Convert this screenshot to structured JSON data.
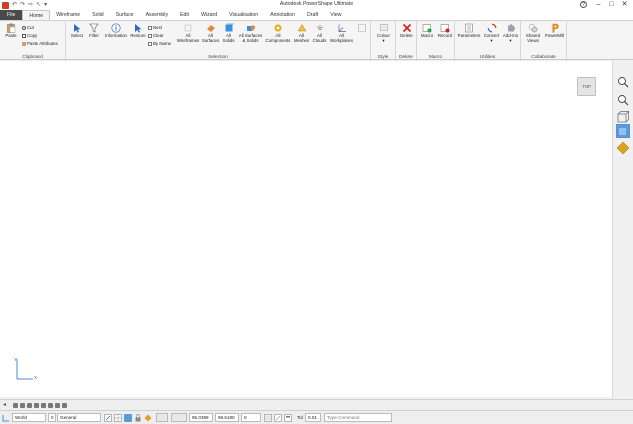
{
  "window": {
    "title": "Autodesk PowerShape Ultimate",
    "help_glyph": "?",
    "minimize": "–",
    "maximize": "□",
    "close": "✕"
  },
  "qat": {
    "icons": [
      "app-logo-icon",
      "undo-icon",
      "redo-icon",
      "pin-icon",
      "select-icon",
      "dropdown-icon"
    ]
  },
  "tabs": [
    "File",
    "Home",
    "Wireframe",
    "Solid",
    "Surface",
    "Assembly",
    "Edit",
    "Wizard",
    "Visualisation",
    "Annotation",
    "Draft",
    "View"
  ],
  "active_tab": "Home",
  "ribbon": {
    "clipboard": {
      "label": "Clipboard",
      "paste": "Paste",
      "cut": "Cut",
      "copy": "Copy",
      "paste_attributes": "Paste Attributes"
    },
    "selection": {
      "label": "Selection",
      "select": "Select",
      "filter": "Filter",
      "information": "Information",
      "restore": "Restore",
      "next": "Next",
      "clear": "Clear",
      "by_name": "By Name",
      "all_wireframes": [
        "All",
        "Wireframes"
      ],
      "all_surfaces": [
        "All",
        "Surfaces"
      ],
      "all_solids": [
        "All",
        "Solids"
      ],
      "all_surfaces_solids": [
        "All Surfaces",
        "& Solids"
      ],
      "all_components": [
        "All",
        "Components"
      ],
      "all_meshes": [
        "All",
        "Meshes"
      ],
      "all_clouds": [
        "All",
        "Clouds"
      ],
      "all_workplanes": [
        "All",
        "Workplanes"
      ]
    },
    "style": {
      "label": "Style",
      "colour": "Colour"
    },
    "delete": {
      "label": "Delete",
      "delete": "Delete"
    },
    "macro": {
      "label": "Macro",
      "macro": "Macro",
      "record": "Record"
    },
    "utilities": {
      "label": "Utilities",
      "parameters": "Parameters",
      "convert": "Convert",
      "addins": "Add-Ins"
    },
    "collaborate": {
      "label": "Collaborate",
      "shared_views": [
        "Shared",
        "Views"
      ],
      "powermill": "PowerMill"
    }
  },
  "canvas": {
    "viewcube_label": "TOP",
    "axis_x": "X",
    "axis_y": "Y"
  },
  "view_toolbar": [
    "zoom-fit-icon",
    "zoom-icon",
    "wireframe-box-icon",
    "shaded-view-icon",
    "material-view-icon"
  ],
  "statusbar": {
    "workplane": "World",
    "level": "0",
    "level_name": "General",
    "x": "95.0398",
    "y": "98.6180",
    "z": "0",
    "tol_label": "Tol",
    "tol_value": "0.01",
    "command_placeholder": "Type Command"
  },
  "colors": {
    "file_tab": "#4a4a4a",
    "accent_blue": "#2a6bbd",
    "delete_red": "#d42020",
    "powermill_orange": "#e08a1e"
  }
}
